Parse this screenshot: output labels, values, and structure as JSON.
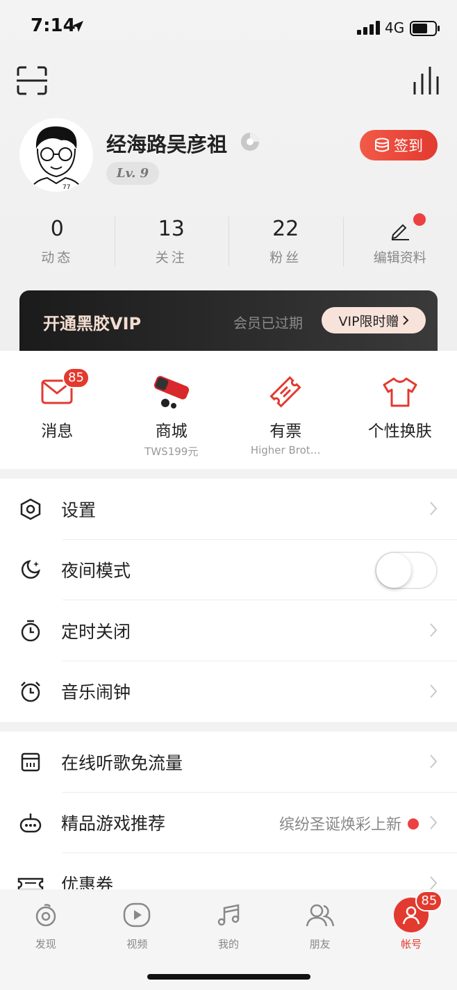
{
  "status": {
    "time": "7:14",
    "network": "4G"
  },
  "profile": {
    "username": "经海路吴彦祖",
    "level": "Lv. 9",
    "signin_label": "签到",
    "avatar_caption": "77"
  },
  "stats": [
    {
      "value": "0",
      "label": "动态"
    },
    {
      "value": "13",
      "label": "关注"
    },
    {
      "value": "22",
      "label": "粉丝"
    },
    {
      "value": "",
      "label": "编辑资料"
    }
  ],
  "vip": {
    "title": "开通黑胶VIP",
    "status": "会员已过期",
    "button": "VIP限时赠"
  },
  "grid": [
    {
      "label": "消息",
      "sub": "",
      "badge": "85",
      "icon": "mail-icon"
    },
    {
      "label": "商城",
      "sub": "TWS199元",
      "icon": "earbuds-product-image"
    },
    {
      "label": "有票",
      "sub": "Higher Brot…",
      "icon": "ticket-icon"
    },
    {
      "label": "个性换肤",
      "sub": "",
      "icon": "tshirt-icon"
    }
  ],
  "settings_group": [
    {
      "label": "设置",
      "icon": "hexagon-settings-icon"
    },
    {
      "label": "夜间模式",
      "icon": "moon-icon",
      "toggle": false
    },
    {
      "label": "定时关闭",
      "icon": "timer-icon"
    },
    {
      "label": "音乐闹钟",
      "icon": "alarm-icon"
    }
  ],
  "services_group": [
    {
      "label": "在线听歌免流量",
      "icon": "sim-card-icon"
    },
    {
      "label": "精品游戏推荐",
      "icon": "game-controller-icon",
      "extra": "缤纷圣诞焕彩上新"
    },
    {
      "label": "优惠券",
      "icon": "coupon-icon"
    }
  ],
  "tabs": [
    {
      "label": "发现",
      "icon": "discover-icon"
    },
    {
      "label": "视频",
      "icon": "video-icon"
    },
    {
      "label": "我的",
      "icon": "music-note-icon"
    },
    {
      "label": "朋友",
      "icon": "friends-icon"
    },
    {
      "label": "帐号",
      "icon": "account-icon",
      "active": true,
      "badge": "85"
    }
  ],
  "colors": {
    "accent": "#e23a2f",
    "background": "#f2f2f2"
  }
}
